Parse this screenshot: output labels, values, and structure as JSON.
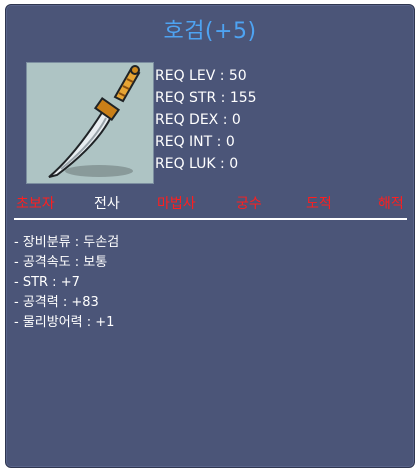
{
  "item": {
    "name": "호검(+5)",
    "image_icon": "curved-sword-icon"
  },
  "requirements": [
    "REQ LEV : 50",
    "REQ STR : 155",
    "REQ DEX : 0",
    "REQ INT : 0",
    "REQ LUK : 0"
  ],
  "jobs": [
    {
      "label": "초보자",
      "color": "#ff1e1e"
    },
    {
      "label": "전사",
      "color": "#ffffff"
    },
    {
      "label": "마법사",
      "color": "#ff1e1e"
    },
    {
      "label": "궁수",
      "color": "#ff1e1e"
    },
    {
      "label": "도적",
      "color": "#ff1e1e"
    },
    {
      "label": "해적",
      "color": "#ff1e1e"
    }
  ],
  "stats": [
    "- 장비분류 : 두손검",
    "- 공격속도 : 보통",
    "- STR : +7",
    "- 공격력 : +83",
    "- 물리방어력 : +1"
  ],
  "colors": {
    "panel_bg": "#4b5578",
    "title": "#4ea3f2",
    "restricted_job": "#ff1e1e",
    "allowed_job": "#ffffff"
  }
}
